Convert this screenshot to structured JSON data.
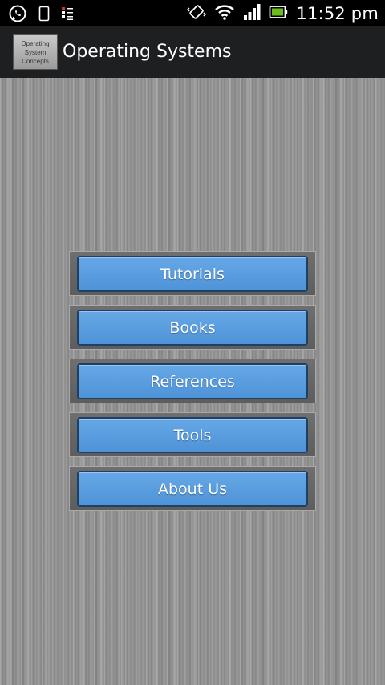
{
  "status_bar": {
    "time": "11:52 pm",
    "left_icons": [
      "whatsapp-icon",
      "phone-icon",
      "tasks-icon"
    ],
    "right_icons": [
      "vibrate-icon",
      "wifi-icon",
      "signal-icon",
      "battery-icon"
    ]
  },
  "app_bar": {
    "logo_lines": [
      "Operating",
      "System",
      "Concepts"
    ],
    "title": "Operating Systems"
  },
  "menu": {
    "items": [
      {
        "label": "Tutorials"
      },
      {
        "label": "Books"
      },
      {
        "label": "References"
      },
      {
        "label": "Tools"
      },
      {
        "label": "About Us"
      }
    ]
  },
  "colors": {
    "button_fill": "#5a9de0",
    "button_border": "#1e3f66",
    "action_bar": "#1e1f21",
    "status_bar": "#000000"
  }
}
